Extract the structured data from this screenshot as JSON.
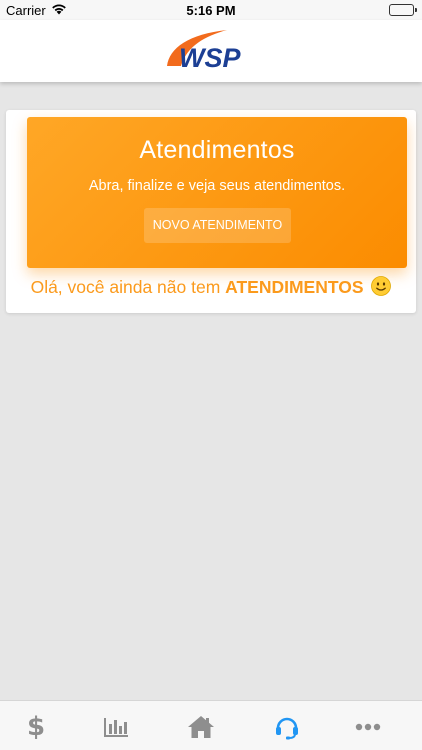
{
  "status_bar": {
    "carrier": "Carrier",
    "time": "5:16 PM"
  },
  "header": {
    "logo_text": "WSP"
  },
  "card": {
    "title": "Atendimentos",
    "subtitle": "Abra, finalize e veja seus atendimentos.",
    "button_label": "NOVO ATENDIMENTO"
  },
  "empty_state": {
    "message_prefix": "Olá, você ainda não tem ",
    "message_emphasis": "ATENDIMENTOS",
    "emoji": "🙂"
  },
  "tab_bar": {
    "items": [
      {
        "icon": "dollar-icon",
        "glyph": "$",
        "active": false
      },
      {
        "icon": "bar-chart-icon",
        "active": false
      },
      {
        "icon": "home-icon",
        "active": false
      },
      {
        "icon": "headset-icon",
        "active": true
      },
      {
        "icon": "more-icon",
        "active": false
      }
    ]
  },
  "colors": {
    "accent_orange": "#fb8c00",
    "active_tab": "#2196f3",
    "inactive_tab": "#8e8e8e"
  }
}
